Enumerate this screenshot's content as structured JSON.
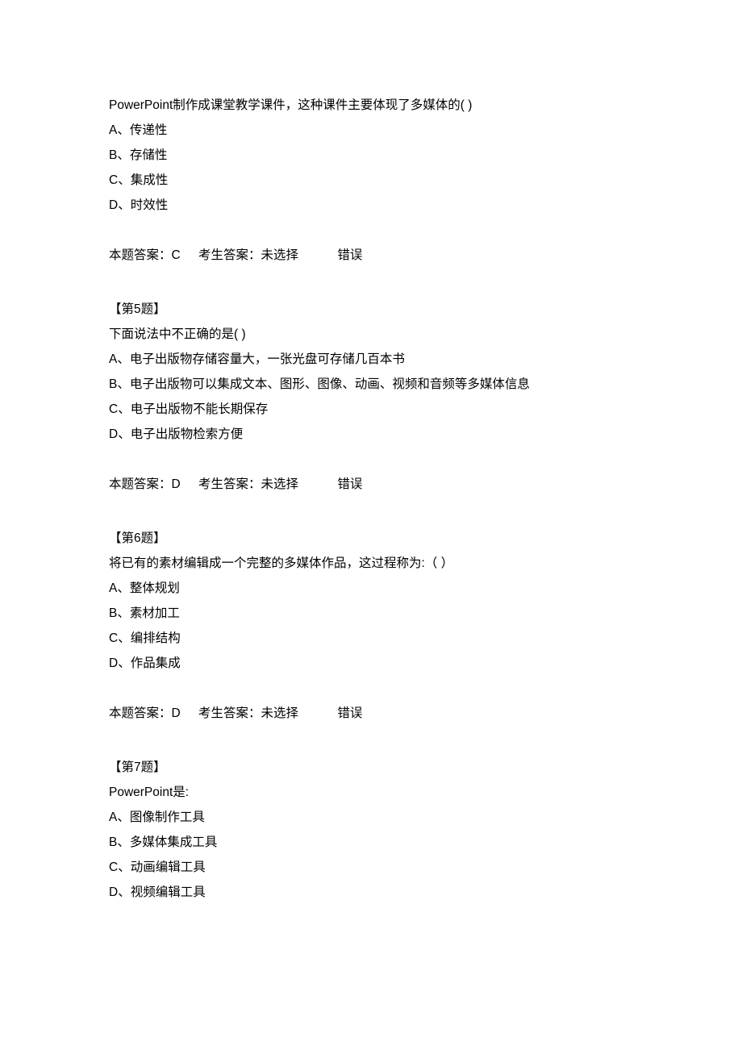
{
  "q4_partial": {
    "stem": "PowerPoint制作成课堂教学课件，这种课件主要体现了多媒体的(  )",
    "options": {
      "A": "A、传递性",
      "B": "B、存储性",
      "C": "C、集成性",
      "D": "D、时效性"
    },
    "answer_label": "本题答案：C",
    "candidate_label": "考生答案：未选择",
    "result": "错误"
  },
  "q5": {
    "header": "【第5题】",
    "stem": "下面说法中不正确的是(  )",
    "options": {
      "A": "A、电子出版物存储容量大，一张光盘可存储几百本书",
      "B": "B、电子出版物可以集成文本、图形、图像、动画、视频和音频等多媒体信息",
      "C": "C、电子出版物不能长期保存",
      "D": "D、电子出版物检索方便"
    },
    "answer_label": "本题答案：D",
    "candidate_label": "考生答案：未选择",
    "result": "错误"
  },
  "q6": {
    "header": "【第6题】",
    "stem": "将已有的素材编辑成一个完整的多媒体作品，这过程称为:（ ）",
    "options": {
      "A": "A、整体规划",
      "B": "B、素材加工",
      "C": "C、编排结构",
      "D": "D、作品集成"
    },
    "answer_label": "本题答案：D",
    "candidate_label": "考生答案：未选择",
    "result": "错误"
  },
  "q7": {
    "header": "【第7题】",
    "stem": "PowerPoint是:",
    "options": {
      "A": "A、图像制作工具",
      "B": "B、多媒体集成工具",
      "C": "C、动画编辑工具",
      "D": "D、视频编辑工具"
    }
  }
}
